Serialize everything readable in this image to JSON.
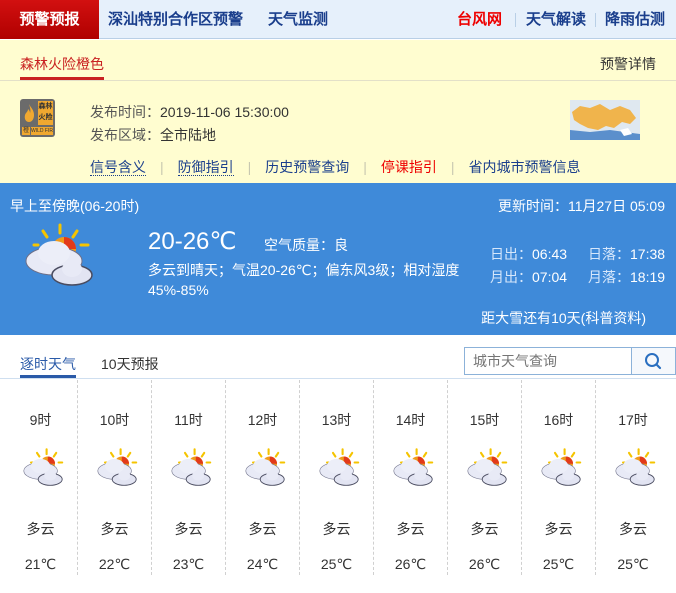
{
  "topnav": {
    "active_tab": "预警预报",
    "left_links": [
      "深汕特别合作区预警",
      "天气监测"
    ],
    "right_links": [
      {
        "label": "台风网",
        "highlight": true
      },
      {
        "label": "天气解读",
        "highlight": false
      },
      {
        "label": "降雨估测",
        "highlight": false
      }
    ]
  },
  "warning": {
    "tab_title": "森林火险橙色",
    "detail_link": "预警详情",
    "badge": {
      "icon": "wildfire-icon",
      "cn_text": "森林火险",
      "level": "橙",
      "en_text": "WILD FIRE",
      "color": "#f0a830"
    },
    "publish_time_label": "发布时间：",
    "publish_time": "2019-11-06 15:30:00",
    "area_label": "发布区域：",
    "area": "全市陆地",
    "links": [
      {
        "label": "信号含义",
        "style": "dotted"
      },
      {
        "label": "防御指引",
        "style": "dotted"
      },
      {
        "label": "历史预警查询",
        "style": "normal"
      },
      {
        "label": "停课指引",
        "style": "red"
      },
      {
        "label": "省内城市预警信息",
        "style": "normal"
      }
    ]
  },
  "today": {
    "period": "早上至傍晚(06-20时)",
    "updated": "更新时间：11月27日 05:09",
    "icon": "partly-cloudy-icon",
    "temp_range": "20-26℃",
    "air_quality_label": "空气质量：",
    "air_quality": "良",
    "description": "多云到晴天；气温20-26℃；偏东风3级；相对湿度45%-85%",
    "sunrise_label": "日出：",
    "sunrise": "06:43",
    "sunset_label": "日落：",
    "sunset": "17:38",
    "moonrise_label": "月出：",
    "moonrise": "07:04",
    "moonset_label": "月落：",
    "moonset": "18:19",
    "countdown": "距大雪还有10天(科普资料)"
  },
  "tabs": {
    "items": [
      "逐时天气",
      "10天预报"
    ],
    "active": 0,
    "search_placeholder": "城市天气查询"
  },
  "hourly": [
    {
      "time": "9时",
      "desc": "多云",
      "temp": "21℃"
    },
    {
      "time": "10时",
      "desc": "多云",
      "temp": "22℃"
    },
    {
      "time": "11时",
      "desc": "多云",
      "temp": "23℃"
    },
    {
      "time": "12时",
      "desc": "多云",
      "temp": "24℃"
    },
    {
      "time": "13时",
      "desc": "多云",
      "temp": "25℃"
    },
    {
      "time": "14时",
      "desc": "多云",
      "temp": "26℃"
    },
    {
      "time": "15时",
      "desc": "多云",
      "temp": "26℃"
    },
    {
      "time": "16时",
      "desc": "多云",
      "temp": "25℃"
    },
    {
      "time": "17时",
      "desc": "多云",
      "temp": "25℃"
    }
  ]
}
